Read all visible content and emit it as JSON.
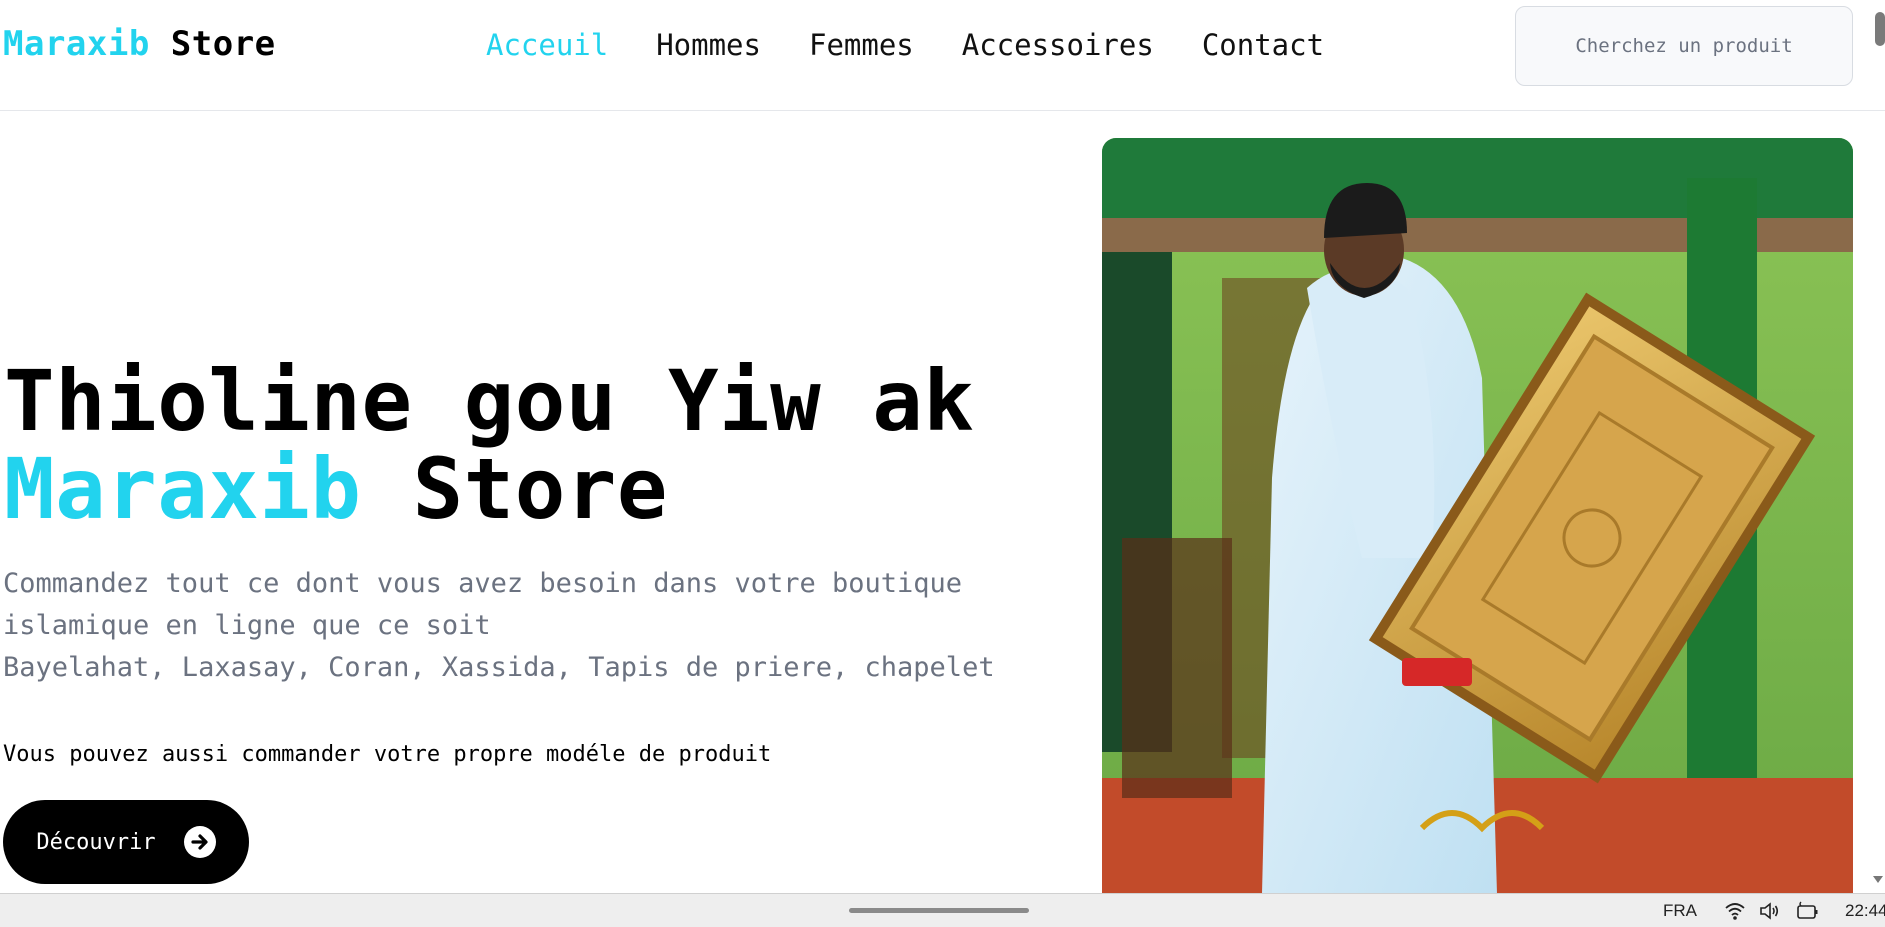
{
  "brand": {
    "part1": "Maraxib",
    "part2": "Store"
  },
  "nav": {
    "items": [
      {
        "label": "Acceuil",
        "active": true
      },
      {
        "label": "Hommes",
        "active": false
      },
      {
        "label": "Femmes",
        "active": false
      },
      {
        "label": "Accessoires",
        "active": false
      },
      {
        "label": "Contact",
        "active": false
      }
    ]
  },
  "search": {
    "placeholder": "Cherchez un produit",
    "value": ""
  },
  "hero": {
    "title_line1": "Thioline gou Yiw ak",
    "title_accent": "Maraxib",
    "title_rest": "Store",
    "description_line1": "Commandez tout ce dont vous avez besoin dans votre boutique islamique en ligne que ce soit",
    "description_line2": "Bayelahat, Laxasay, Coran, Xassida, Tapis de priere, chapelet",
    "note": "Vous pouvez aussi commander votre propre modéle de produit",
    "cta_label": "Découvrir"
  },
  "taskbar": {
    "language": "FRA",
    "time": "22:44"
  },
  "colors": {
    "accent": "#22d3ee",
    "muted_text": "#6b7280",
    "button_bg": "#000000"
  },
  "icons": [
    "arrow-right-circle-icon",
    "wifi-icon",
    "speaker-icon",
    "battery-icon"
  ]
}
